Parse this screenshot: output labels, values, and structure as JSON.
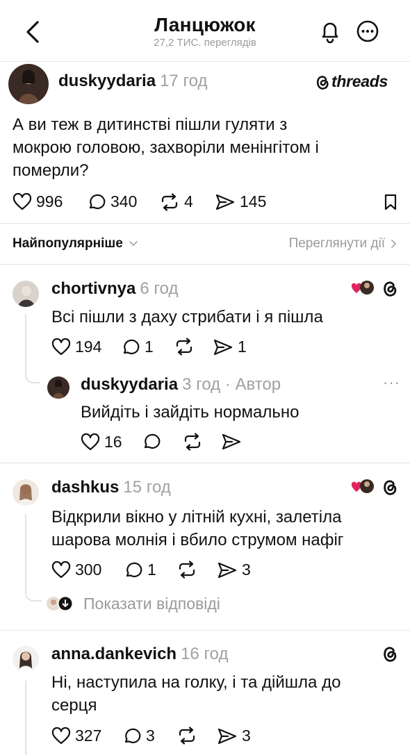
{
  "header": {
    "title": "Ланцюжок",
    "views": "27,2 ТИС. переглядів"
  },
  "post": {
    "username": "duskyydaria",
    "time": "17 год",
    "brand": "threads",
    "text_lines": [
      "А ви теж в дитинстві пішли гуляти з",
      "мокрою головою, захворіли менінгітом і",
      "померли?"
    ],
    "likes": "996",
    "comments": "340",
    "reposts": "4",
    "shares": "145"
  },
  "sort": {
    "label": "Найпопулярніше",
    "activity": "Переглянути дії"
  },
  "replies": [
    {
      "username": "chortivnya",
      "time": "6 год",
      "text": "Всі пішли з даху стрибати і я пішла",
      "likes": "194",
      "comments": "1",
      "reposts": "",
      "shares": "1",
      "nested": {
        "username": "duskyydaria",
        "time": "3 год · Автор",
        "text": "Вийдіть і зайдіть нормально",
        "likes": "16"
      }
    },
    {
      "username": "dashkus",
      "time": "15 год",
      "text_lines": [
        "Відкрили вікно у літній кухні, залетіла",
        "шарова молнія і вбило струмом нафіг"
      ],
      "likes": "300",
      "comments": "1",
      "reposts": "",
      "shares": "3",
      "show_replies": "Показати відповіді"
    },
    {
      "username": "anna.dankevich",
      "time": "16 год",
      "text_lines": [
        "Ні, наступила на голку, і та дійшла до",
        "серця"
      ],
      "likes": "327",
      "comments": "3",
      "reposts": "",
      "shares": "3"
    }
  ],
  "colors": {
    "text": "#111111",
    "muted": "#9a9a9a",
    "divider": "#e3e3e3",
    "heart": "#e0245e"
  }
}
